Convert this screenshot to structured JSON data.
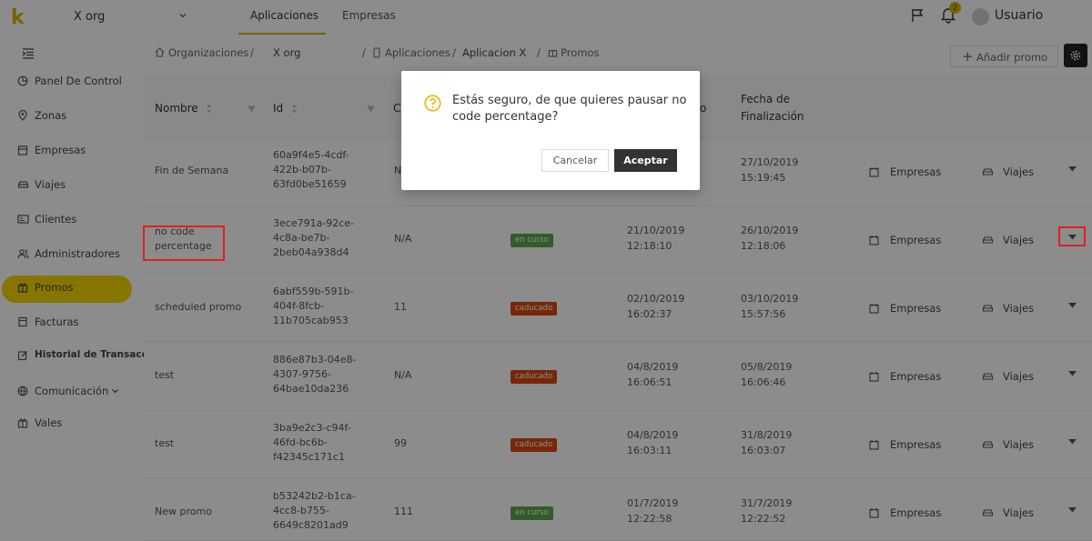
{
  "header": {
    "logo": "k",
    "org_name": "X org",
    "tabs": [
      {
        "label": "Aplicaciones"
      },
      {
        "label": "Empresas"
      }
    ],
    "notification_count": "2",
    "user_name": "Usuario"
  },
  "sidebar": {
    "items": [
      {
        "label": "Panel De Control",
        "icon": "chart-pie-icon"
      },
      {
        "label": "Zonas",
        "icon": "location-pin-icon"
      },
      {
        "label": "Empresas",
        "icon": "building-icon"
      },
      {
        "label": "Viajes",
        "icon": "car-icon"
      },
      {
        "label": "Clientes",
        "icon": "id-card-icon"
      },
      {
        "label": "Administradores",
        "icon": "users-icon"
      },
      {
        "label": "Promos",
        "icon": "gift-icon"
      },
      {
        "label": "Facturas",
        "icon": "invoice-icon"
      },
      {
        "label": "Historial de Transacciones",
        "icon": "edit-icon"
      },
      {
        "label": "Comunicación",
        "icon": "globe-icon"
      },
      {
        "label": "Vales",
        "icon": "gift-icon"
      }
    ]
  },
  "breadcrumb": {
    "home": "Organizaciones",
    "org": "X org",
    "apps": "Aplicaciones",
    "app": "Aplicacion X",
    "current": "Promos",
    "sep": "/"
  },
  "toolbar": {
    "add_label": "Añadir promo"
  },
  "table": {
    "headers": {
      "nombre": "Nombre",
      "id": "Id",
      "c": "C",
      "end_1": "Fecha de",
      "end_2": "Finalización",
      "start_tail": "o"
    },
    "link_empresas": "Empresas",
    "link_viajes": "Viajes",
    "rows": [
      {
        "name1": "Fin de Semana",
        "name2": "",
        "id1": "60a9f4e5-4cdf-",
        "id2": "422b-b07b-",
        "id3": "63fd0be51659",
        "code": "N",
        "status": "",
        "start1": "",
        "start2": "",
        "end1": "27/10/2019",
        "end2": "15:19:45"
      },
      {
        "name1": "no code",
        "name2": "percentage",
        "id1": "3ece791a-92ce-",
        "id2": "4c8a-be7b-",
        "id3": "2beb04a938d4",
        "code": "N/A",
        "status": "en curso",
        "start1": "21/10/2019",
        "start2": "12:18:10",
        "end1": "26/10/2019",
        "end2": "12:18:06"
      },
      {
        "name1": "scheduled promo",
        "name2": "",
        "id1": "6abf559b-591b-",
        "id2": "404f-8fcb-",
        "id3": "11b705cab953",
        "code": "11",
        "status": "caducado",
        "start1": "02/10/2019",
        "start2": "16:02:37",
        "end1": "03/10/2019",
        "end2": "15:57:56"
      },
      {
        "name1": "test",
        "name2": "",
        "id1": "886e87b3-04e8-",
        "id2": "4307-9756-",
        "id3": "64bae10da236",
        "code": "N/A",
        "status": "caducado",
        "start1": "04/8/2019",
        "start2": "16:06:51",
        "end1": "05/8/2019",
        "end2": "16:06:46"
      },
      {
        "name1": "test",
        "name2": "",
        "id1": "3ba9e2c3-c94f-",
        "id2": "46fd-bc6b-",
        "id3": "f42345c171c1",
        "code": "99",
        "status": "caducado",
        "start1": "04/8/2019",
        "start2": "16:03:11",
        "end1": "31/8/2019",
        "end2": "16:03:07"
      },
      {
        "name1": "New promo",
        "name2": "",
        "id1": "b53242b2-b1ca-",
        "id2": "4cc8-b755-",
        "id3": "6649c8201ad9",
        "code": "111",
        "status": "en curso",
        "start1": "01/7/2019",
        "start2": "12:22:58",
        "end1": "31/7/2019",
        "end2": "12:22:52"
      }
    ]
  },
  "modal": {
    "message": "Estás seguro, de que quieres pausar no code percentage?",
    "cancel_label": "Cancelar",
    "ok_label": "Aceptar"
  },
  "colors": {
    "accent": "#f5d600",
    "en_curso": "#5aa84a",
    "caducado": "#d9480f",
    "highlight": "#e02020"
  }
}
